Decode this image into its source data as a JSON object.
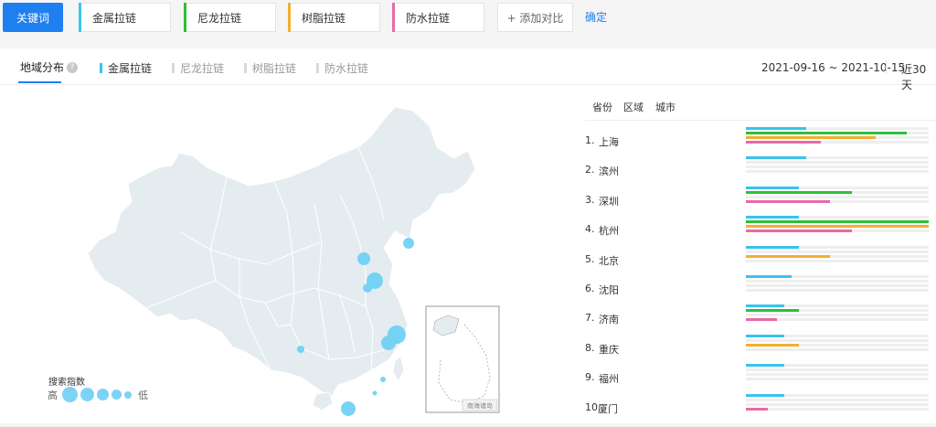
{
  "top": {
    "keyword_button": "关键词",
    "tags": [
      {
        "label": "金属拉链",
        "color": "#39c3ee"
      },
      {
        "label": "尼龙拉链",
        "color": "#2dbf3a"
      },
      {
        "label": "树脂拉链",
        "color": "#f3ae33"
      },
      {
        "label": "防水拉链",
        "color": "#e86aa6"
      }
    ],
    "add_label": "+ 添加对比",
    "confirm_label": "确定"
  },
  "tabs": {
    "main": "地域分布",
    "help": "?",
    "legend": [
      {
        "label": "金属拉链",
        "color": "#39c3ee",
        "active": true
      },
      {
        "label": "尼龙拉链",
        "color": "#d9d9d9",
        "active": false
      },
      {
        "label": "树脂拉链",
        "color": "#d9d9d9",
        "active": false
      },
      {
        "label": "防水拉链",
        "color": "#d9d9d9",
        "active": false
      }
    ],
    "date_range": "2021-09-16 ~ 2021-10-15",
    "period": "近30天"
  },
  "map": {
    "legend_title": "搜索指数",
    "legend_high": "高",
    "legend_low": "低",
    "inset_label": "南海诸岛",
    "bubble_color": "#6ad0f5"
  },
  "ranking": {
    "headers": [
      "省份",
      "区域",
      "城市"
    ],
    "rows": [
      {
        "rank": "1.",
        "city": "上海",
        "values": [
          0.33,
          0.88,
          0.71,
          0.41
        ]
      },
      {
        "rank": "2.",
        "city": "滨州",
        "values": [
          0.33,
          0,
          0,
          0
        ]
      },
      {
        "rank": "3.",
        "city": "深圳",
        "values": [
          0.29,
          0.58,
          0,
          0.46
        ]
      },
      {
        "rank": "4.",
        "city": "杭州",
        "values": [
          0.29,
          1.0,
          1.0,
          0.58
        ]
      },
      {
        "rank": "5.",
        "city": "北京",
        "values": [
          0.29,
          0,
          0.46,
          0
        ]
      },
      {
        "rank": "6.",
        "city": "沈阳",
        "values": [
          0.25,
          0,
          0,
          0
        ]
      },
      {
        "rank": "7.",
        "city": "济南",
        "values": [
          0.21,
          0.29,
          0,
          0.17
        ]
      },
      {
        "rank": "8.",
        "city": "重庆",
        "values": [
          0.21,
          0,
          0.29,
          0
        ]
      },
      {
        "rank": "9.",
        "city": "福州",
        "values": [
          0.21,
          0,
          0,
          0
        ]
      },
      {
        "rank": "10.",
        "city": "厦门",
        "values": [
          0.21,
          0,
          0,
          0.12
        ]
      }
    ],
    "series_colors": [
      "#39c3ee",
      "#2dbf3a",
      "#f3ae33",
      "#e86aa6"
    ]
  }
}
